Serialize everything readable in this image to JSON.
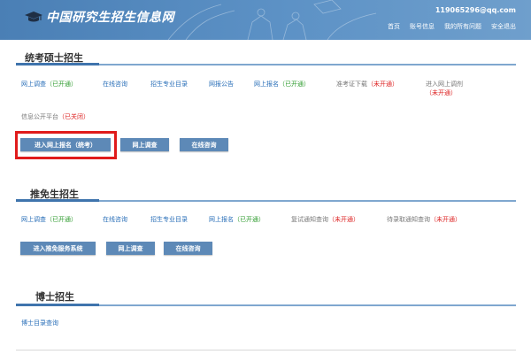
{
  "header": {
    "site_title": "中国研究生招生信息网",
    "email": "119065296@qq.com",
    "nav": [
      "首页",
      "账号信息",
      "我的所有问题",
      "安全退出"
    ]
  },
  "section1": {
    "title": "统考硕士招生",
    "links": [
      {
        "text": "网上调查",
        "status": "（已开通）"
      },
      {
        "text": "在线咨询"
      },
      {
        "text": "招生专业目录"
      },
      {
        "text": "网报公告"
      },
      {
        "text": "网上报名",
        "status": "（已开通）"
      },
      {
        "text": "准考证下载",
        "status": "（未开通）"
      },
      {
        "text": "进入网上调剂",
        "status": "（未开通）"
      },
      {
        "text": "信息公开平台",
        "status": "（已关闭）"
      }
    ],
    "buttons": [
      "进入网上报名（统考）",
      "网上调查",
      "在线咨询"
    ]
  },
  "section2": {
    "title": "推免生招生",
    "links": [
      {
        "text": "网上调查",
        "status": "（已开通）"
      },
      {
        "text": "在线咨询"
      },
      {
        "text": "招生专业目录"
      },
      {
        "text": "网上报名",
        "status": "（已开通）"
      },
      {
        "text": "复试通知查询",
        "status": "（未开通）"
      },
      {
        "text": "待录取通知查询",
        "status": "（未开通）"
      }
    ],
    "buttons": [
      "进入推免服务系统",
      "网上调查",
      "在线咨询"
    ]
  },
  "section3": {
    "title": "博士招生",
    "links": [
      {
        "text": "博士目录查询"
      }
    ]
  },
  "colors": {
    "header_bg": "#5d92c6",
    "button_bg": "#5d89b7",
    "link": "#2a6fb8",
    "open": "#2e9b2e",
    "closed": "#d22",
    "highlight": "#e01b1b"
  }
}
